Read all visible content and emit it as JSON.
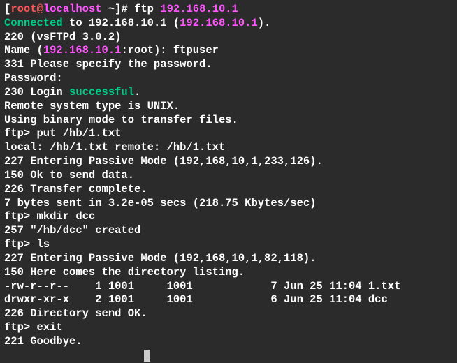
{
  "prompt": {
    "user": "root",
    "at": "@",
    "host": "localhost",
    "tilde": " ~",
    "hash": "]# ",
    "cmd": "ftp ",
    "ip": "192.168.10.1"
  },
  "l1": {
    "a": "Connected",
    "b": " to 192.168.10.1 (",
    "c": "192.168.10.1",
    "d": ")."
  },
  "l2": "220 (vsFTPd 3.0.2)",
  "l3": {
    "a": "Name (",
    "b": "192.168.10.1",
    "c": ":root): ftpuser"
  },
  "l4": "331 Please specify the password.",
  "l5": "Password:",
  "l6": {
    "a": "230 Login ",
    "b": "successful",
    "c": "."
  },
  "l7": "Remote system type is UNIX.",
  "l8": "Using binary mode to transfer files.",
  "l9": "ftp> put /hb/1.txt",
  "l10": "local: /hb/1.txt remote: /hb/1.txt",
  "l11": "227 Entering Passive Mode (192,168,10,1,233,126).",
  "l12": "150 Ok to send data.",
  "l13": "226 Transfer complete.",
  "l14": "7 bytes sent in 3.2e-05 secs (218.75 Kbytes/sec)",
  "l15": "ftp> mkdir dcc",
  "l16": "257 \"/hb/dcc\" created",
  "l17": "ftp> ls",
  "l18": "227 Entering Passive Mode (192,168,10,1,82,118).",
  "l19": "150 Here comes the directory listing.",
  "l20": "-rw-r--r--    1 1001     1001            7 Jun 25 11:04 1.txt",
  "l21": "drwxr-xr-x    2 1001     1001            6 Jun 25 11:04 dcc",
  "l22": "226 Directory send OK.",
  "l23": "ftp> exit",
  "l24": "221 Goodbye."
}
